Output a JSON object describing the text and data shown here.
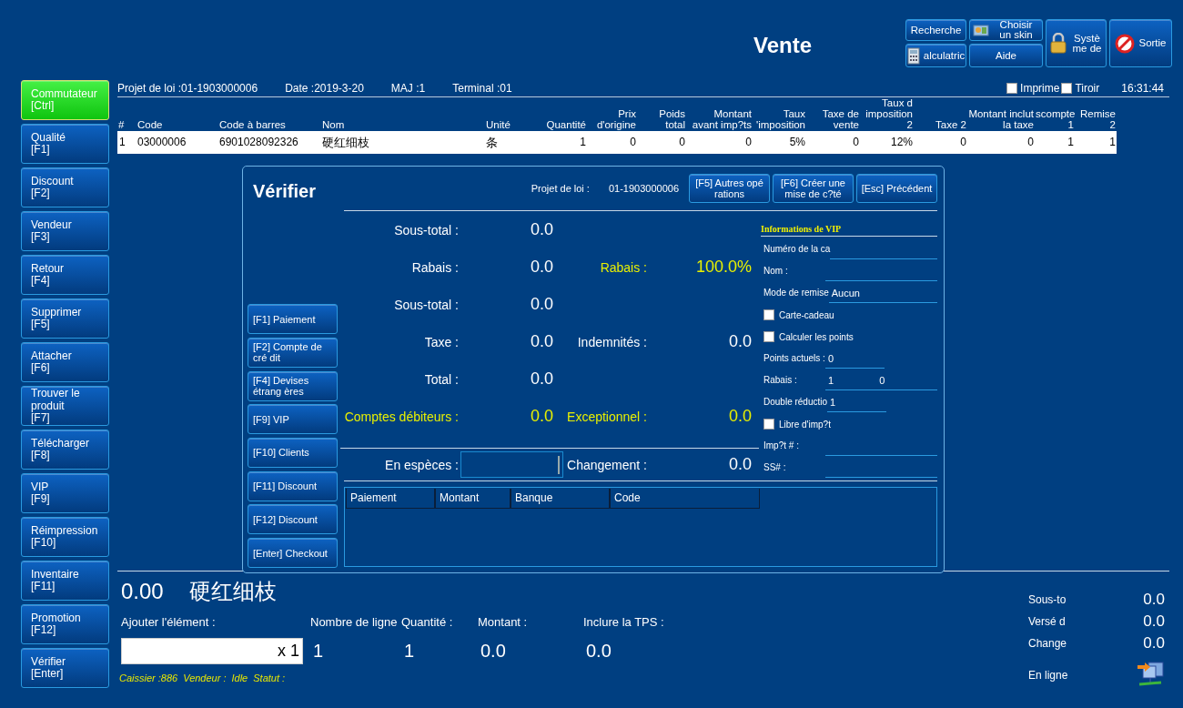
{
  "header": {
    "title": "Vente",
    "buttons": [
      "Recherche",
      "Choisir un skin",
      "Systè me de",
      "Sortie",
      "alculatric",
      "Aide"
    ],
    "checkboxes": [
      {
        "label": "Imprime",
        "checked": false
      },
      {
        "label": "Tiroir",
        "checked": false
      }
    ],
    "time": "16:31:44"
  },
  "sidebar": [
    {
      "label": "Commutateur",
      "key": "[Ctrl]",
      "selected": true
    },
    {
      "label": "Qualité",
      "key": "[F1]",
      "selected": false
    },
    {
      "label": "Discount",
      "key": "[F2]",
      "selected": false
    },
    {
      "label": "Vendeur",
      "key": "[F3]",
      "selected": false
    },
    {
      "label": "Retour",
      "key": "[F4]",
      "selected": false
    },
    {
      "label": "Supprimer",
      "key": "[F5]",
      "selected": false
    },
    {
      "label": "Attacher",
      "key": "[F6]",
      "selected": false
    },
    {
      "label": "Trouver le produit",
      "key": "[F7]",
      "selected": false
    },
    {
      "label": "Télécharger",
      "key": "[F8]",
      "selected": false
    },
    {
      "label": "VIP",
      "key": "[F9]",
      "selected": false
    },
    {
      "label": "Réimpression",
      "key": "[F10]",
      "selected": false
    },
    {
      "label": "Inventaire",
      "key": "[F11]",
      "selected": false
    },
    {
      "label": "Promotion",
      "key": "[F12]",
      "selected": false
    },
    {
      "label": "Vérifier",
      "key": "[Enter]",
      "selected": false
    }
  ],
  "info_bar": [
    "Projet de loi :01-1903000006",
    "Date :2019-3-20",
    "MAJ :1",
    "Terminal :01"
  ],
  "table": {
    "columns": [
      "#",
      "Code",
      "Code à barres",
      "Nom",
      "Unité",
      "Quantité",
      "Prix d'origine",
      "Poids total",
      "Montant avant imp?ts",
      "Taux 'imposition",
      "Taxe de vente",
      "Taux d imposition 2",
      "Taxe 2",
      "Montant inclut la taxe",
      "scompte 1",
      "Remise 2"
    ],
    "rows": [
      [
        "1",
        "03000006",
        "6901028092326",
        "硬红细枝",
        "条",
        "1",
        "0",
        "0",
        "0",
        "5%",
        "0",
        "12%",
        "0",
        "0",
        "1",
        "1"
      ]
    ]
  },
  "bottom": {
    "total": "0.00",
    "product": "硬红细枝",
    "add_label": "Ajouter l'élément :",
    "multiplier": "x 1",
    "stats": [
      {
        "label": "Nombre de ligne",
        "value": "1"
      },
      {
        "label": "Quantité :",
        "value": "1"
      },
      {
        "label": "Montant :",
        "value": "0.0"
      },
      {
        "label": "Inclure la TPS :",
        "value": "0.0"
      }
    ],
    "status": [
      "Caissier :886",
      "Vendeur :",
      "Idle",
      "Statut :"
    ],
    "summary": [
      {
        "label": "Sous-to",
        "value": "0.0"
      },
      {
        "label": "Versé d",
        "value": "0.0"
      },
      {
        "label": "Change",
        "value": "0.0"
      }
    ],
    "connection": "En ligne"
  },
  "dialog": {
    "title": "Vérifier",
    "bill_label": "Projet de loi :",
    "bill_number": "01-1903000006",
    "header_buttons": [
      "[F5] Autres opé rations",
      "[F6] Créer une mise de c?té",
      "[Esc] Précédent"
    ],
    "side_buttons": [
      "[F1] Paiement",
      "[F2] Compte de cré dit",
      "[F4] Devises étrang ères",
      "[F9] VIP",
      "[F10] Clients",
      "[F11] Discount",
      "[F12] Discount",
      "[Enter] Checkout"
    ],
    "summary": [
      {
        "left": {
          "label": "Sous-total :",
          "value": "0.0",
          "highlighted": false
        }
      },
      {
        "left": {
          "label": "Rabais :",
          "value": "0.0",
          "highlighted": false
        },
        "right": {
          "label": "Rabais :",
          "value": "100.0%",
          "highlighted": true
        }
      },
      {
        "left": {
          "label": "Sous-total :",
          "value": "0.0",
          "highlighted": false
        }
      },
      {
        "left": {
          "label": "Taxe :",
          "value": "0.0",
          "highlighted": false
        },
        "right": {
          "label": "Indemnités :",
          "value": "0.0",
          "highlighted": false
        }
      },
      {
        "left": {
          "label": "Total :",
          "value": "0.0",
          "highlighted": false
        }
      },
      {
        "left": {
          "label": "Comptes débiteurs :",
          "value": "0.0",
          "highlighted": true
        },
        "right": {
          "label": "Exceptionnel :",
          "value": "0.0",
          "highlighted": true
        }
      }
    ],
    "cash": {
      "label": "En espèces :",
      "change_label": "Changement :",
      "change_value": "0.0"
    },
    "payment_columns": [
      "Paiement",
      "Montant",
      "Banque",
      "Code"
    ],
    "vip": {
      "title": "Informations de VIP",
      "rows": [
        {
          "kind": "field",
          "label": "Numéro de la ca",
          "values": []
        },
        {
          "kind": "field",
          "label": "Nom :",
          "values": []
        },
        {
          "kind": "field",
          "label": "Mode de remise",
          "values": [
            "Aucun"
          ]
        },
        {
          "kind": "checkbox",
          "label": "Carte-cadeau",
          "checked": false
        },
        {
          "kind": "checkbox",
          "label": "Calculer les points",
          "checked": false
        },
        {
          "kind": "short",
          "label": "Points actuels :",
          "values": [
            "0"
          ]
        },
        {
          "kind": "field",
          "label": "Rabais :",
          "values": [
            "1",
            "0"
          ]
        },
        {
          "kind": "short",
          "label": "Double réductio",
          "values": [
            "1"
          ]
        },
        {
          "kind": "checkbox",
          "label": "Libre d'imp?t",
          "checked": false
        },
        {
          "kind": "field",
          "label": "Imp?t # :",
          "values": []
        },
        {
          "kind": "field",
          "label": "SS# :",
          "values": []
        }
      ]
    }
  }
}
